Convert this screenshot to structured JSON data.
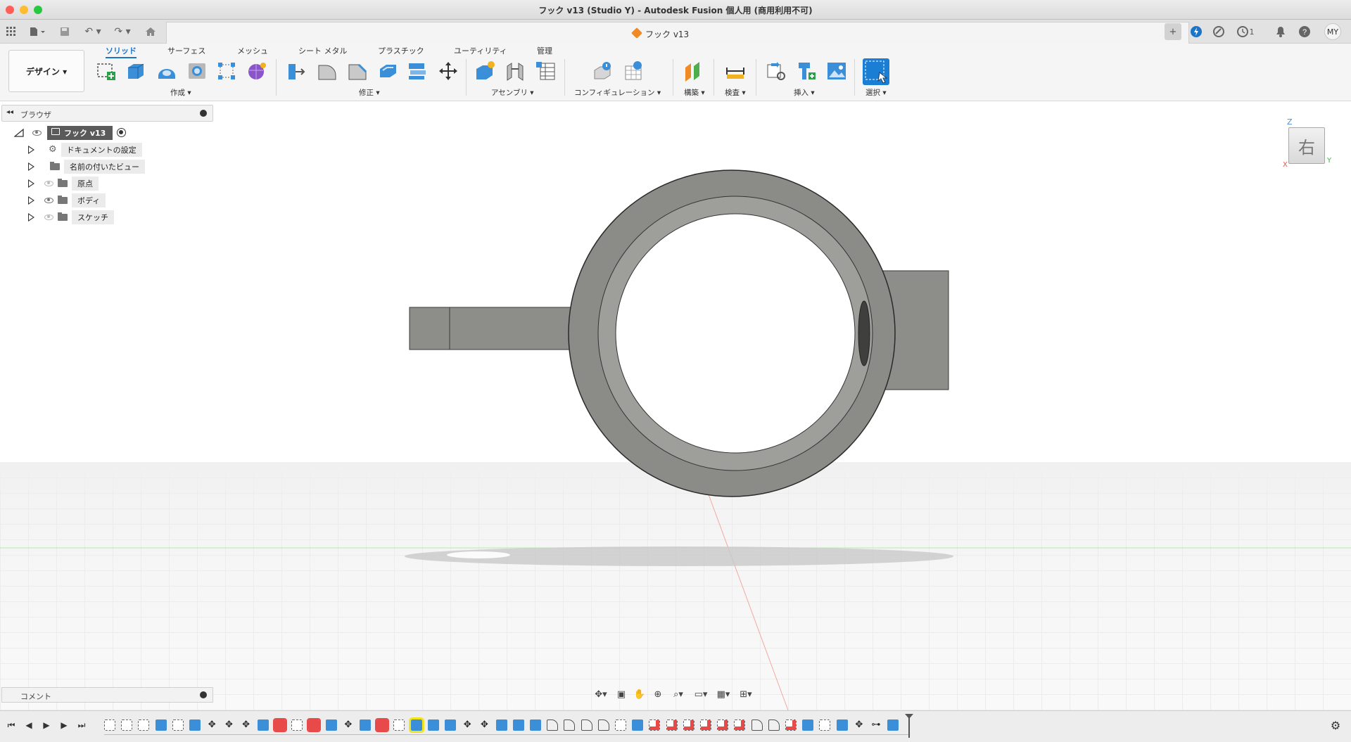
{
  "window": {
    "title": "フック v13 (Studio Y) - Autodesk Fusion 個人用 (商用利用不可)",
    "traffic_colors": [
      "#ff5f57",
      "#febc2e",
      "#28c840"
    ]
  },
  "tabs": {
    "document_name": "フック v13",
    "close_glyph": "×",
    "new_tab_glyph": "+",
    "job_count": "1",
    "user_initials": "MY"
  },
  "ribbon": {
    "workspace_label": "デザイン ▾",
    "tabs": [
      "ソリッド",
      "サーフェス",
      "メッシュ",
      "シート メタル",
      "プラスチック",
      "ユーティリティ",
      "管理"
    ],
    "groups": {
      "create": "作成 ▾",
      "modify": "修正 ▾",
      "assemble": "アセンブリ ▾",
      "configure": "コンフィギュレーション ▾",
      "construct": "構築 ▾",
      "inspect": "検査 ▾",
      "insert": "挿入 ▾",
      "select": "選択 ▾"
    },
    "accent": "#1a74c8"
  },
  "browser": {
    "title": "ブラウザ",
    "root": "フック v13",
    "items": [
      {
        "label": "ドキュメントの設定",
        "icon": "gear-icon"
      },
      {
        "label": "名前の付いたビュー",
        "icon": "folder-icon"
      },
      {
        "label": "原点",
        "icon": "folder-icon"
      },
      {
        "label": "ボディ",
        "icon": "folder-icon"
      },
      {
        "label": "スケッチ",
        "icon": "folder-icon"
      }
    ]
  },
  "viewcube": {
    "face_label": "右",
    "axis_z": "Z",
    "axis_y": "Y",
    "axis_x": "X"
  },
  "comments": {
    "title": "コメント"
  },
  "timeline": {
    "play_glyphs": [
      "⏮",
      "◀",
      "▶",
      "▶",
      "⏭"
    ],
    "settings_glyph": "⚙"
  }
}
